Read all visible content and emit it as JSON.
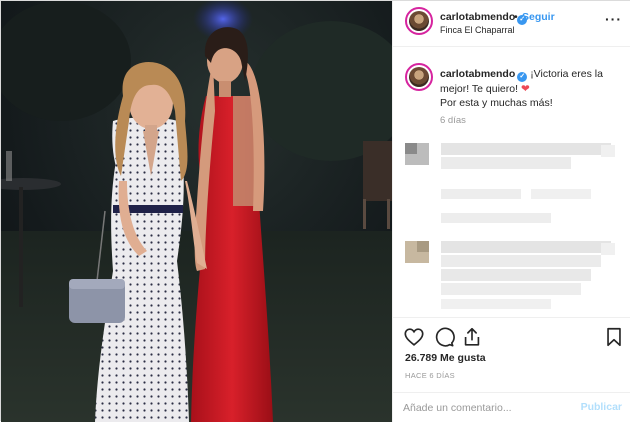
{
  "post": {
    "username": "carlotabmendo",
    "follow_label": "Seguir",
    "separator": "•",
    "location": "Finca El Chaparral",
    "more_label": "···"
  },
  "caption": {
    "username": "carlotabmendo",
    "text": "¡Victoria eres la mejor! Te quiero!",
    "heart": "❤",
    "text2": "Por esta y muchas más!",
    "time": "6 días"
  },
  "actions": {
    "likes": "26.789 Me gusta",
    "timestamp": "HACE 6 DÍAS",
    "comment_placeholder": "Añade un comentario...",
    "publish_label": "Publicar"
  },
  "colors": {
    "link_blue": "#3897f0",
    "publish_disabled": "#b2dffc",
    "heart_red": "#ed4956",
    "muted": "#999999"
  },
  "icons": [
    "heart-icon",
    "comment-icon",
    "share-icon",
    "bookmark-icon",
    "verified-badge-icon",
    "more-options-icon"
  ]
}
